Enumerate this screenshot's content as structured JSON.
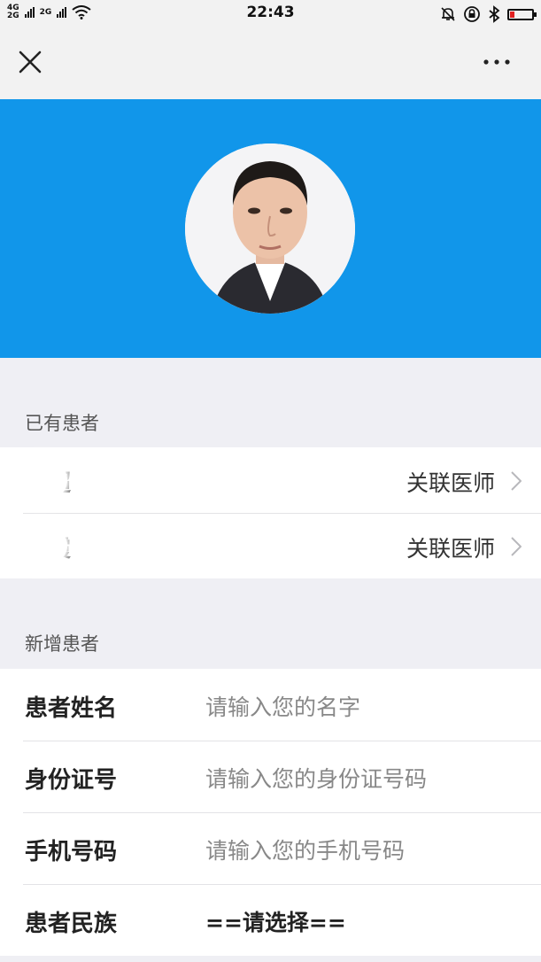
{
  "status": {
    "network_top": "4G",
    "network_bottom": "2G",
    "network2": "2G",
    "time": "22:43"
  },
  "nav": {
    "close_icon": "close-icon",
    "more_icon": "more-dots-icon"
  },
  "existing": {
    "title": "已有患者",
    "patients": [
      {
        "name": "超",
        "link": "关联医师"
      },
      {
        "name": "霞",
        "link": "关联医师"
      }
    ]
  },
  "new_patient": {
    "title": "新增患者",
    "fields": [
      {
        "label": "患者姓名",
        "placeholder": "请输入您的名字"
      },
      {
        "label": "身份证号",
        "placeholder": "请输入您的身份证号码"
      },
      {
        "label": "手机号码",
        "placeholder": "请输入您的手机号码"
      },
      {
        "label": "患者民族",
        "value": "==请选择=="
      }
    ]
  },
  "colors": {
    "hero": "#1196ea",
    "background": "#efeff4"
  }
}
